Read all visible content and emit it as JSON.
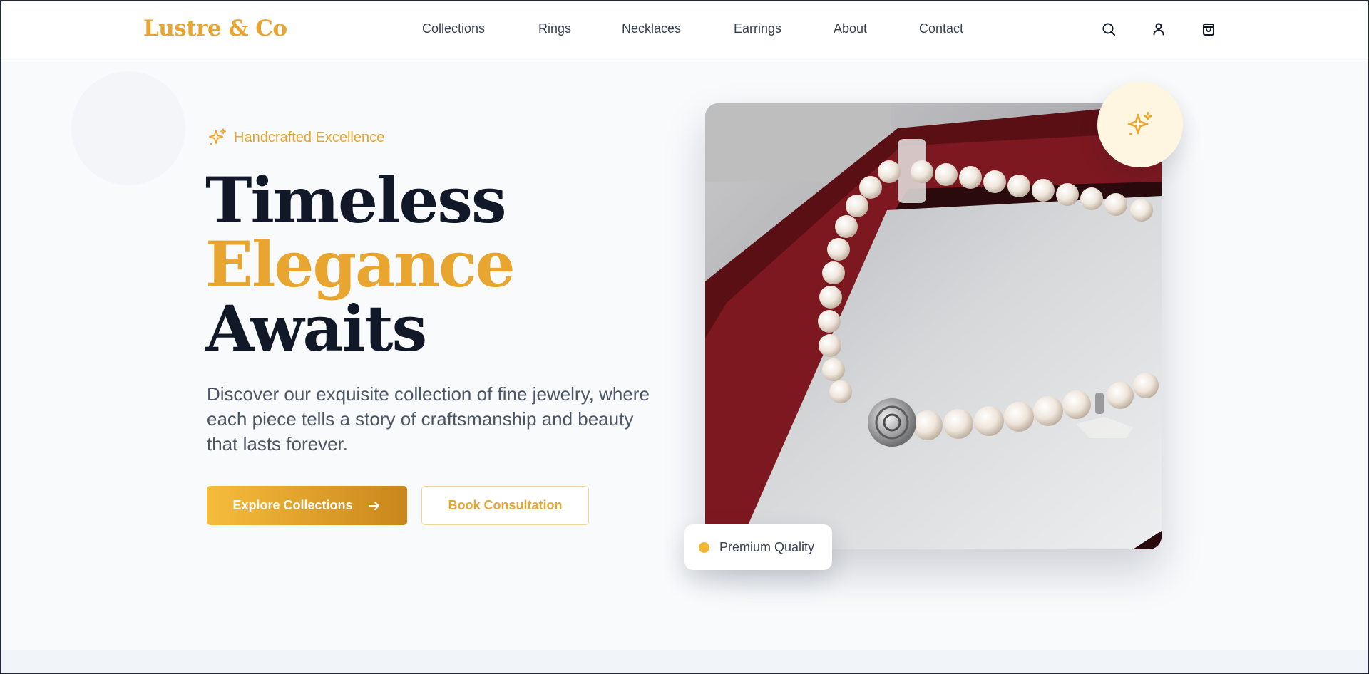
{
  "brand": {
    "logo": "Lustre & Co",
    "accent": "#e8a530"
  },
  "nav": {
    "items": [
      "Collections",
      "Rings",
      "Necklaces",
      "Earrings",
      "About",
      "Contact"
    ]
  },
  "header_icons": [
    "search-icon",
    "user-icon",
    "shopping-bag-icon"
  ],
  "hero": {
    "tagline": "Handcrafted Excellence",
    "headline": {
      "line1": "Timeless",
      "line2": "Elegance",
      "line3": "Awaits"
    },
    "description": "Discover our exquisite collection of fine jewelry, where each piece tells a story of craftsmanship and beauty that lasts forever.",
    "primary_button": "Explore Collections",
    "secondary_button": "Book Consultation",
    "image_subject": "pearl necklace in jewelry box",
    "badge": "Premium Quality"
  },
  "colors": {
    "gold": "#e8a530",
    "gold_gradient_start": "#f6bd3c",
    "gold_gradient_end": "#c9861b",
    "heading": "#111827",
    "body_text": "#4b5563"
  }
}
